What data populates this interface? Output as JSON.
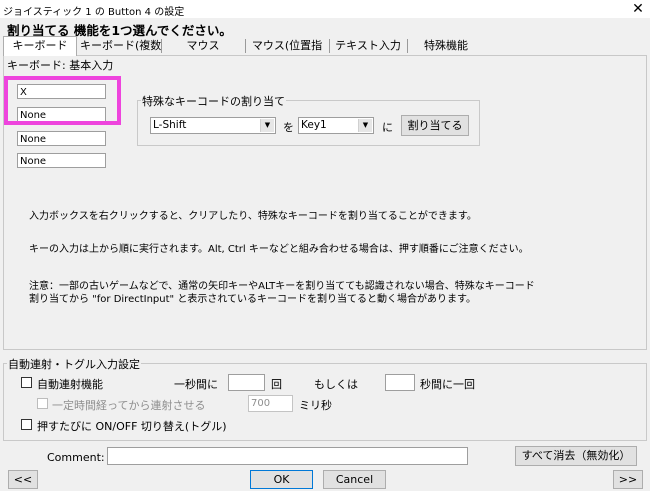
{
  "window": {
    "title": "ジョイスティック 1 の Button 4 の設定",
    "close_glyph": "✕"
  },
  "heading": "割り当てる 機能を1つ選んでください。",
  "tabs": [
    {
      "label": "キーボード",
      "active": true
    },
    {
      "label": "キーボード(複数"
    },
    {
      "label": "マウス"
    },
    {
      "label": "マウス(位置指"
    },
    {
      "label": "テキスト入力"
    },
    {
      "label": "特殊機能"
    }
  ],
  "keyboard_group": {
    "title": "キーボード: 基本入力",
    "boxes": [
      "X",
      "None",
      "None",
      "None"
    ]
  },
  "special_group": {
    "title": "特殊なキーコードの割り当て",
    "modifier_value": "L-Shift",
    "wo_label": "を",
    "key_value": "Key1",
    "ni_label": "に",
    "assign_button": "割り当てる"
  },
  "info": {
    "line1": "入力ボックスを右クリックすると、クリアしたり、特殊なキーコードを割り当てることができます。",
    "line2": "キーの入力は上から順に実行されます。Alt, Ctrl キーなどと組み合わせる場合は、押す順番にご注意ください。",
    "line3a": "注意：一部の古いゲームなどで、通常の矢印キーやALTキーを割り当てても認識されない場合、特殊なキーコード",
    "line3b": "割り当てから \"for DirectInput\" と表示されているキーコードを割り当てると動く場合があります。"
  },
  "auto": {
    "title": "自動連射・トグル入力設定",
    "auto_fire_label": "自動連射機能",
    "per_second_label": "一秒間に",
    "per_second_value": "",
    "times_label": "回",
    "or_label": "もしくは",
    "seconds_value": "",
    "seconds_label": "秒間に一回",
    "delay_label": "一定時間経ってから連射させる",
    "delay_value": "700",
    "ms_label": "ミリ秒",
    "toggle_label": "押すたびに ON/OFF 切り替え(トグル)"
  },
  "footer": {
    "comment_label": "Comment:",
    "comment_value": "",
    "clear_all_button": "すべて消去（無効化）",
    "prev_button": "<<",
    "ok_button": "OK",
    "cancel_button": "Cancel",
    "next_button": ">>"
  }
}
